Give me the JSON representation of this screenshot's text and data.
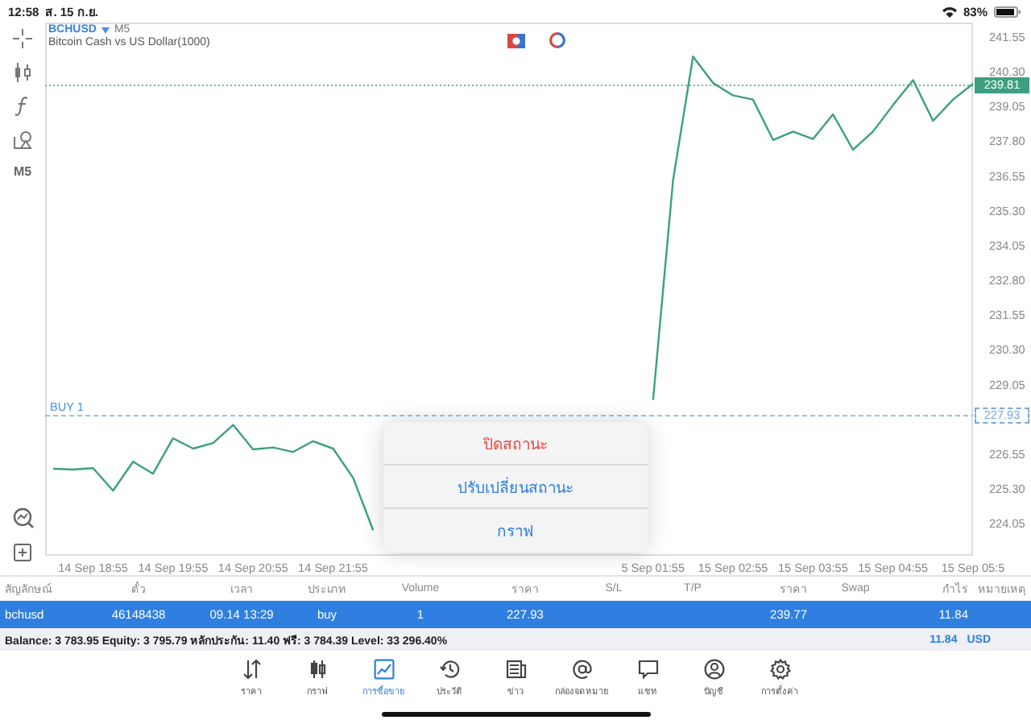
{
  "status_bar": {
    "time": "12:58",
    "date": "ส. 15 ก.ย.",
    "battery": "83%"
  },
  "toolbar": {
    "timeframe": "M5"
  },
  "chart": {
    "symbol": "BCHUSD",
    "timeframe": "M5",
    "description": "Bitcoin Cash vs US Dollar(1000)",
    "order": {
      "text": "BUY 1"
    },
    "chart_data": {
      "type": "line",
      "ylim": [
        222.9,
        242.07
      ],
      "ref_lines": [
        {
          "axis": "y",
          "value": 239.81,
          "label": "239.81",
          "color": "#3d9f80"
        },
        {
          "axis": "y",
          "value": 227.93,
          "label": "227.93",
          "color": "#7aa8e0"
        }
      ],
      "categories": [
        null,
        null,
        "14 Sep 18:55",
        null,
        null,
        null,
        "14 Sep 19:55",
        null,
        null,
        null,
        "14 Sep 20:55",
        null,
        null,
        null,
        "14 Sep 21:55",
        null,
        null,
        null,
        null,
        null,
        null,
        null,
        null,
        null,
        null,
        null,
        null,
        null,
        null,
        null,
        "5 Sep 01:55",
        null,
        null,
        null,
        "15 Sep 02:55",
        null,
        null,
        null,
        "15 Sep 03:55",
        null,
        null,
        null,
        "15 Sep 04:55",
        null,
        null,
        null,
        "15 Sep 05:5"
      ],
      "series": [
        {
          "color": "#3d9f80",
          "values": [
            226.03,
            226.0,
            226.05,
            225.24,
            226.28,
            225.85,
            227.12,
            226.75,
            226.95,
            227.6,
            226.72,
            226.79,
            226.63,
            227.02,
            226.75,
            225.7,
            223.82,
            null,
            null,
            null,
            null,
            null,
            null,
            null,
            null,
            null,
            null,
            null,
            null,
            null,
            228.5,
            236.4,
            240.85,
            239.9,
            239.45,
            239.3,
            237.85,
            238.15,
            237.88,
            238.77,
            237.5,
            238.15,
            239.1,
            240.0,
            238.54,
            239.3,
            239.87
          ]
        }
      ],
      "yticks": [
        {
          "value": 241.55,
          "label": "241.55"
        },
        {
          "value": 240.3,
          "label": "240.30"
        },
        {
          "value": 239.05,
          "label": "239.05"
        },
        {
          "value": 237.8,
          "label": "237.80"
        },
        {
          "value": 236.55,
          "label": "236.55"
        },
        {
          "value": 235.3,
          "label": "235.30"
        },
        {
          "value": 234.05,
          "label": "234.05"
        },
        {
          "value": 232.8,
          "label": "232.80"
        },
        {
          "value": 231.55,
          "label": "231.55"
        },
        {
          "value": 230.3,
          "label": "230.30"
        },
        {
          "value": 229.05,
          "label": "229.05"
        },
        {
          "value": 226.55,
          "label": "226.55"
        },
        {
          "value": 225.3,
          "label": "225.30"
        },
        {
          "value": 224.05,
          "label": "224.05"
        }
      ]
    }
  },
  "context_menu": [
    {
      "label": "ปิดสถานะ",
      "kind": "destructive"
    },
    {
      "label": "ปรับเปลี่ยนสถานะ",
      "kind": "default"
    },
    {
      "label": "กราฟ",
      "kind": "default"
    }
  ],
  "table": {
    "columns": [
      "สัญลักษณ์",
      "ตั๋ว",
      "เวลา",
      "ประเภท",
      "Volume",
      "ราคา",
      "S/L",
      "T/P",
      "ราคา",
      "Swap",
      "กำไร",
      "หมายเหตุ"
    ],
    "rows": [
      {
        "selected": true,
        "cells": [
          "bchusd",
          "46148438",
          "09.14 13:29",
          "buy",
          "1",
          "227.93",
          null,
          null,
          "239.77",
          null,
          "11.84",
          null
        ]
      }
    ]
  },
  "account": {
    "summary": "Balance: 3 783.95 Equity: 3 795.79 หลักประกัน: 11.40 ฟรี: 3 784.39 Level: 33 296.40%",
    "profit": "11.84",
    "currency": "USD"
  },
  "tabs": [
    {
      "label": "ราคา",
      "kind": "quotes",
      "selected": false
    },
    {
      "label": "กราฟ",
      "kind": "chart",
      "selected": false
    },
    {
      "label": "การซื้อขาย",
      "kind": "trade",
      "selected": true
    },
    {
      "label": "ประวัติ",
      "kind": "history",
      "selected": false
    },
    {
      "label": "ข่าว",
      "kind": "news",
      "selected": false
    },
    {
      "label": "กล่องจดหมาย",
      "kind": "mail",
      "selected": false
    },
    {
      "label": "แชท",
      "kind": "chat",
      "selected": false
    },
    {
      "label": "บัญชี",
      "kind": "account",
      "selected": false
    },
    {
      "label": "การตั้งค่า",
      "kind": "settings",
      "selected": false
    }
  ]
}
